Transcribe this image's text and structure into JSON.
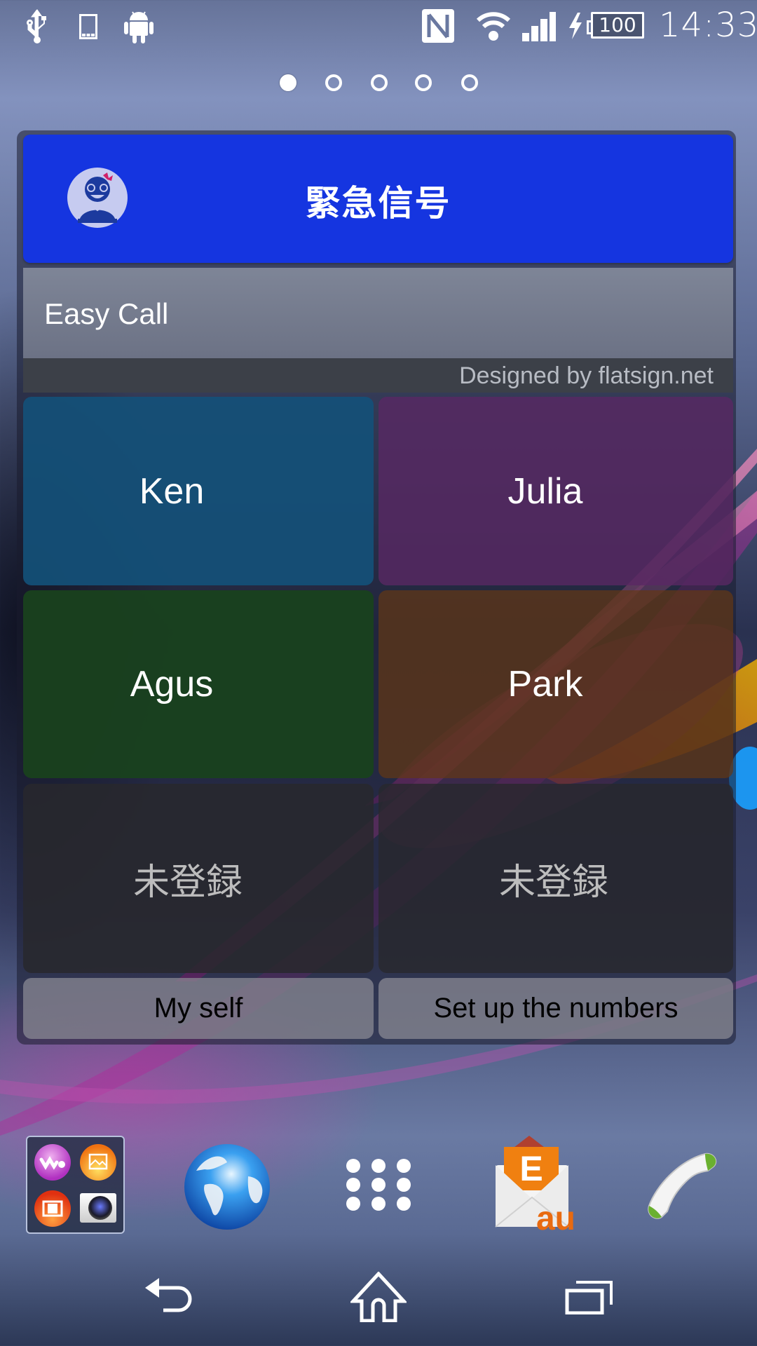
{
  "status_bar": {
    "left_icons": [
      "usb-debugging-icon",
      "device-icon",
      "android-icon"
    ],
    "right_icons": [
      "nfc-icon",
      "wifi-icon",
      "cell-signal-icon",
      "charging-bolt-icon",
      "battery-icon"
    ],
    "battery_level": "100",
    "time": "14:33"
  },
  "home": {
    "pages": 5,
    "current_page": 1
  },
  "widget": {
    "title": "緊急信号",
    "avatar_icon": "girl-avatar-icon",
    "app_name": "Easy Call",
    "credit": "Designed by flatsign.net",
    "contacts": [
      {
        "label": "Ken",
        "color": "#14506f"
      },
      {
        "label": "Julia",
        "color": "#5a2864"
      },
      {
        "label": "Agus",
        "color": "#19411e"
      },
      {
        "label": "Park",
        "color": "#643714"
      },
      {
        "label": "未登録",
        "color": "#28282d"
      },
      {
        "label": "未登録",
        "color": "#28282d"
      }
    ],
    "buttons": {
      "myself": "My self",
      "setup": "Set up the numbers"
    },
    "header_color": "#1535e0"
  },
  "dock": {
    "items": [
      {
        "name": "media-folder",
        "contents": [
          "walkman-icon",
          "album-icon",
          "movies-icon",
          "camera-icon"
        ]
      },
      {
        "name": "browser",
        "icon": "globe-icon"
      },
      {
        "name": "app-drawer",
        "icon": "app-grid-icon"
      },
      {
        "name": "au-email",
        "icon": "email-icon",
        "badge_letter": "E",
        "brand": "au"
      },
      {
        "name": "phone",
        "icon": "phone-handset-icon"
      }
    ]
  },
  "navbar": {
    "buttons": [
      "back",
      "home",
      "recent-apps"
    ]
  }
}
